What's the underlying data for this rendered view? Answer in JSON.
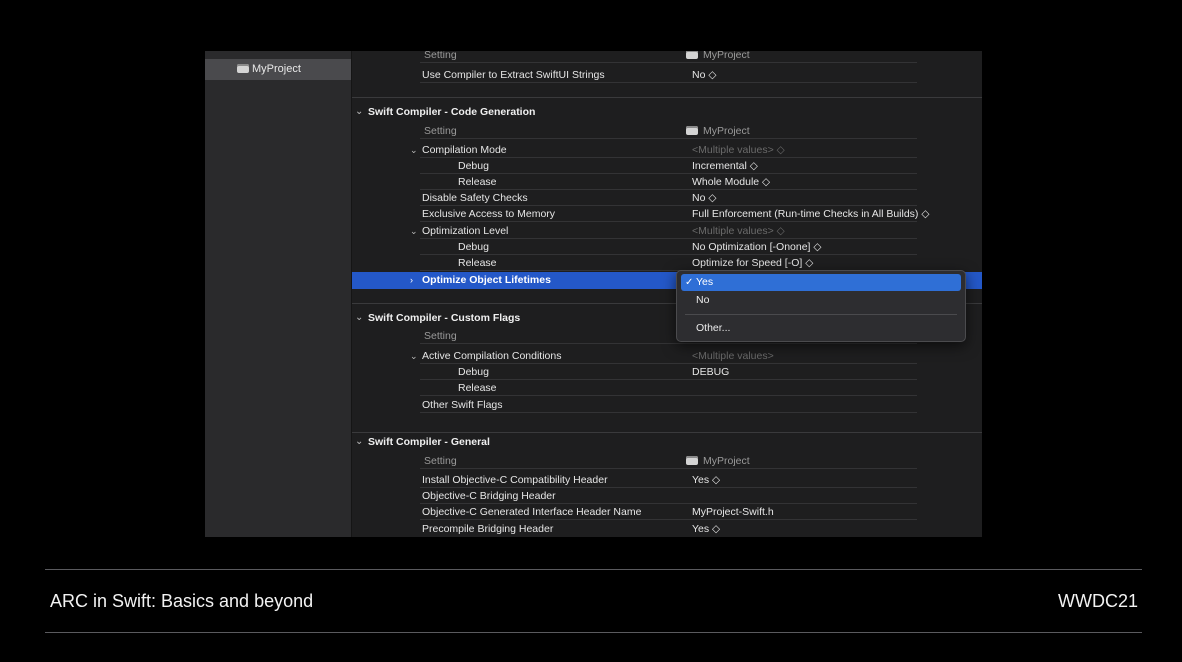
{
  "sidebar": {
    "project": "MyProject"
  },
  "partial_top": {
    "header_setting": "Setting",
    "header_target": "MyProject",
    "row": {
      "name": "Use Compiler to Extract SwiftUI Strings",
      "value": "No ◇"
    }
  },
  "codegen": {
    "title": "Swift Compiler - Code Generation",
    "header_setting": "Setting",
    "header_target": "MyProject",
    "compilation_mode": {
      "name": "Compilation Mode",
      "value": "<Multiple values> ◇",
      "debug": {
        "name": "Debug",
        "value": "Incremental ◇"
      },
      "release": {
        "name": "Release",
        "value": "Whole Module ◇"
      }
    },
    "disable_safety": {
      "name": "Disable Safety Checks",
      "value": "No ◇"
    },
    "exclusive_access": {
      "name": "Exclusive Access to Memory",
      "value": "Full Enforcement (Run-time Checks in All Builds) ◇"
    },
    "optimization_level": {
      "name": "Optimization Level",
      "value": "<Multiple values> ◇",
      "debug": {
        "name": "Debug",
        "value": "No Optimization [-Onone] ◇"
      },
      "release": {
        "name": "Release",
        "value": "Optimize for Speed [-O] ◇"
      }
    },
    "optimize_lifetimes": {
      "name": "Optimize Object Lifetimes"
    }
  },
  "custom_flags": {
    "title": "Swift Compiler - Custom Flags",
    "header_setting": "Setting",
    "active_conditions": {
      "name": "Active Compilation Conditions",
      "value": "<Multiple values>",
      "debug": {
        "name": "Debug",
        "value": "DEBUG"
      },
      "release": {
        "name": "Release"
      }
    },
    "other_flags": {
      "name": "Other Swift Flags"
    }
  },
  "general": {
    "title": "Swift Compiler - General",
    "header_setting": "Setting",
    "header_target": "MyProject",
    "install_header": {
      "name": "Install Objective-C Compatibility Header",
      "value": "Yes ◇"
    },
    "bridging_header": {
      "name": "Objective-C Bridging Header"
    },
    "interface_header": {
      "name": "Objective-C Generated Interface Header Name",
      "value": "MyProject-Swift.h"
    },
    "precompile_bridging": {
      "name": "Precompile Bridging Header",
      "value": "Yes ◇"
    }
  },
  "popup": {
    "check": "✓",
    "options": [
      "Yes",
      "No",
      "Other..."
    ],
    "selected": "Yes"
  },
  "footer": {
    "session_title": "ARC in Swift: Basics and beyond",
    "event": "WWDC21"
  },
  "colors": {
    "selection": "#2458c8",
    "popup_highlight": "#2f6fd6",
    "background": "#000000"
  },
  "icons": {
    "chevron_down": "⌄",
    "chevron_right": "›"
  }
}
